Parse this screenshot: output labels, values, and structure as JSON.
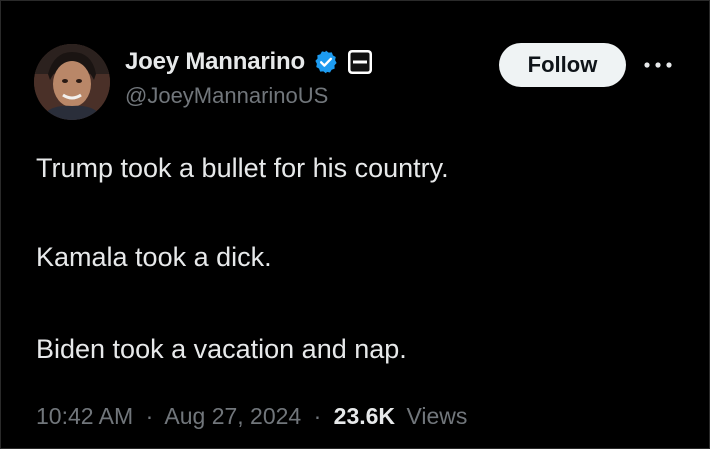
{
  "author": {
    "display_name": "Joey Mannarino",
    "handle": "@JoeyMannarinoUS",
    "avatar_icon": "profile-photo",
    "verified_icon": "verified-badge-icon",
    "verified_color": "#1d9bf0",
    "affiliation_icon": "affiliation-badge-icon"
  },
  "actions": {
    "follow_label": "Follow",
    "more_icon": "more-dots-icon"
  },
  "tweet": {
    "lines": [
      "Trump took a bullet for his country.",
      "Kamala took a dick.",
      "Biden took a vacation and nap."
    ]
  },
  "meta": {
    "time": "10:42 AM",
    "separator": "·",
    "date": "Aug 27, 2024",
    "views_count": "23.6K",
    "views_label": "Views"
  },
  "colors": {
    "background": "#000000",
    "primary_text": "#e7e9ea",
    "secondary_text": "#71767b",
    "follow_bg": "#eff3f4",
    "follow_text": "#0f1419"
  }
}
